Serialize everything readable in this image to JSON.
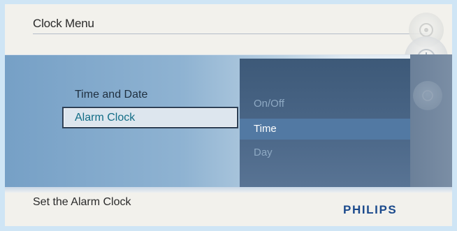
{
  "header": {
    "title": "Clock Menu"
  },
  "menu": {
    "items": [
      {
        "label": "Time and Date"
      },
      {
        "label": "Alarm Clock"
      }
    ],
    "selected_index": 1
  },
  "submenu": {
    "items": [
      {
        "label": "On/Off"
      },
      {
        "label": "Time"
      },
      {
        "label": "Day"
      }
    ],
    "selected_index": 1
  },
  "footer": {
    "status_text": "Set the Alarm Clock",
    "brand": "PHILIPS"
  },
  "side_icons": [
    {
      "icon": "settings-icon"
    },
    {
      "icon": "clock-icon"
    },
    {
      "icon": "photo-icon"
    }
  ],
  "colors": {
    "brand": "#1b4a8c",
    "selected_text": "#126d86",
    "submenu_bg": "#4b6788",
    "submenu_highlight": "#5279a3"
  }
}
